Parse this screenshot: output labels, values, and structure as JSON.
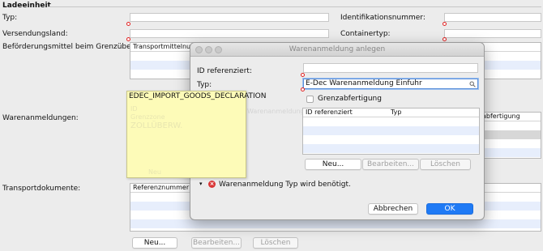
{
  "main": {
    "section_title": "Ladeeinheit",
    "labels": {
      "typ": "Typ:",
      "identifikationsnummer": "Identifikationsnummer:",
      "versendungsland": "Versendungsland:",
      "containertyp": "Containertyp:",
      "befoerderungsmittel": "Beförderungsmittel beim Grenzübertritt:",
      "warenanmeldungen": "Warenanmeldungen:",
      "transportdokumente": "Transportdokumente:"
    },
    "transport_table_header": "Transportmittelnumm",
    "waren_table_header_right": "abfertigung",
    "docs_table_header": "Referenznummer",
    "buttons": {
      "new": "Neu...",
      "edit": "Bearbeiten...",
      "delete": "Löschen"
    }
  },
  "dialog": {
    "title": "Warenanmeldung anlegen",
    "labels": {
      "id_referenziert": "ID referenziert:",
      "typ": "Typ:"
    },
    "typ_value": "E-Dec Warenanmeldung Einfuhr",
    "checkbox_label": "Grenzabfertigung",
    "table_headers": [
      "ID referenziert",
      "Typ"
    ],
    "hidden_header_text": "Warenanmeldungen Beziehungen",
    "buttons": {
      "new": "Neu...",
      "edit": "Bearbeiten...",
      "delete": "Löschen"
    },
    "error_message": "Warenanmeldung Typ wird benötigt.",
    "cancel_label": "Abbrechen",
    "ok_label": "OK"
  },
  "tooltip": {
    "text": "EDEC_IMPORT_GOODS_DECLARATION",
    "faded_lines": [
      "ID",
      "Grenzzone",
      "ZOLLÜBERW.",
      "Neu"
    ]
  },
  "colors": {
    "accent": "#1f7af5",
    "error": "#e02020",
    "tooltip_bg": "#fdfbb8"
  }
}
